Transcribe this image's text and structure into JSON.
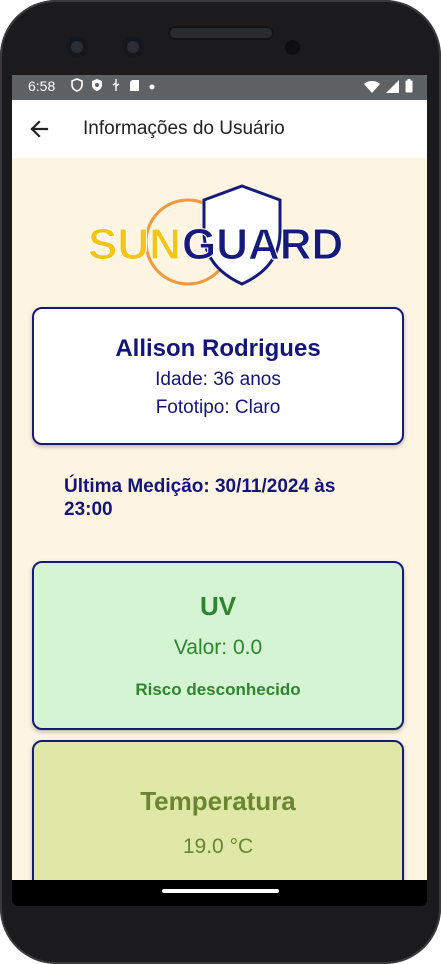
{
  "status_bar": {
    "time": "6:58",
    "left_icons": [
      "shield-outline-icon",
      "shield-filled-icon",
      "usb-icon",
      "sd-card-icon",
      "dot-icon"
    ],
    "right_icons": [
      "wifi-icon",
      "signal-icon",
      "battery-icon"
    ]
  },
  "app_bar": {
    "title": "Informações do Usuário",
    "back_icon": "arrow-back-icon"
  },
  "logo": {
    "text_part1": "SUN",
    "text_part2": "GUARD",
    "color_yellow": "#f6c416",
    "color_navy": "#161a7a",
    "color_orange": "#f29a3b"
  },
  "user_card": {
    "name": "Allison Rodrigues",
    "age": "Idade: 36 anos",
    "phototype": "Fototipo: Claro"
  },
  "last_measure": "Última Medição: 30/11/2024 às 23:00",
  "uv_card": {
    "title": "UV",
    "value": "Valor: 0.0",
    "risk": "Risco desconhecido",
    "bg_color": "#d4f4d4",
    "text_color": "#2f852f"
  },
  "temperature_card": {
    "title": "Temperatura",
    "value": "19.0 °C",
    "bg_color": "#dfe8a6",
    "text_color": "#6a8630"
  }
}
